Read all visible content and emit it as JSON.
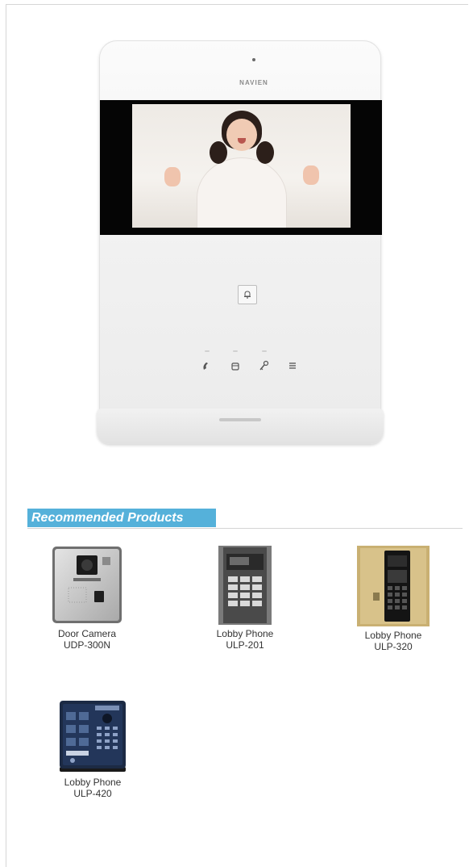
{
  "main_product": {
    "brand_text": "NAVIEN",
    "image": "video-doorphone-monitor"
  },
  "section": {
    "title": "Recommended Products"
  },
  "products": [
    {
      "line1": "Door Camera",
      "line2": "UDP-300N"
    },
    {
      "line1": "Lobby Phone",
      "line2": "ULP-201"
    },
    {
      "line1": "Lobby Phone",
      "line2": "ULP-320"
    },
    {
      "line1": "Lobby Phone",
      "line2": "ULP-420"
    }
  ],
  "colors": {
    "section_header_bg": "#55b1da",
    "section_header_text": "#ffffff",
    "caption_text": "#333333"
  }
}
